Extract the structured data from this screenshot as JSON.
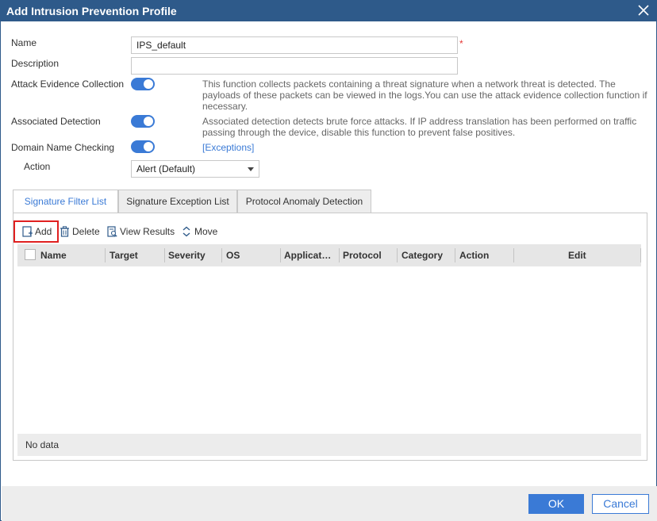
{
  "dialog": {
    "title": "Add Intrusion Prevention Profile"
  },
  "form": {
    "name_label": "Name",
    "name_value": "IPS_default",
    "required_mark": "*",
    "description_label": "Description",
    "description_value": "",
    "attack_evidence_label": "Attack Evidence Collection",
    "attack_evidence_enabled": true,
    "attack_evidence_desc_1": "This function collects packets containing a threat signature when a network threat is detected. The",
    "attack_evidence_desc_2": "payloads of these packets can be viewed in the logs.You can use the attack evidence collection function if",
    "attack_evidence_desc_3": "necessary.",
    "associated_detection_label": "Associated Detection",
    "associated_detection_enabled": true,
    "associated_detection_desc_1": "Associated detection detects brute force attacks. If IP address translation has been performed on traffic",
    "associated_detection_desc_2": "passing through the device, disable this function to prevent false positives.",
    "domain_check_label": "Domain Name Checking",
    "domain_check_enabled": true,
    "exceptions_link": "[Exceptions]",
    "action_label": "Action",
    "action_value": "Alert (Default)"
  },
  "tabs": [
    {
      "label": "Signature Filter List",
      "active": true
    },
    {
      "label": "Signature Exception List",
      "active": false
    },
    {
      "label": "Protocol Anomaly Detection",
      "active": false
    }
  ],
  "toolbar": {
    "add": "Add",
    "delete": "Delete",
    "view_results": "View Results",
    "move": "Move"
  },
  "table": {
    "columns": [
      "Name",
      "Target",
      "Severity",
      "OS",
      "Applicat…",
      "Protocol",
      "Category",
      "Action",
      "Edit"
    ],
    "rows": [],
    "empty_text": "No data"
  },
  "footer": {
    "ok": "OK",
    "cancel": "Cancel"
  },
  "colors": {
    "title_bar": "#2e5a8a",
    "accent": "#3a7ad6",
    "required": "#e53935",
    "highlight_box": "#e02020"
  },
  "icons": [
    "close-icon",
    "add-icon",
    "delete-icon",
    "view-results-icon",
    "move-icon",
    "chevron-down-icon"
  ]
}
